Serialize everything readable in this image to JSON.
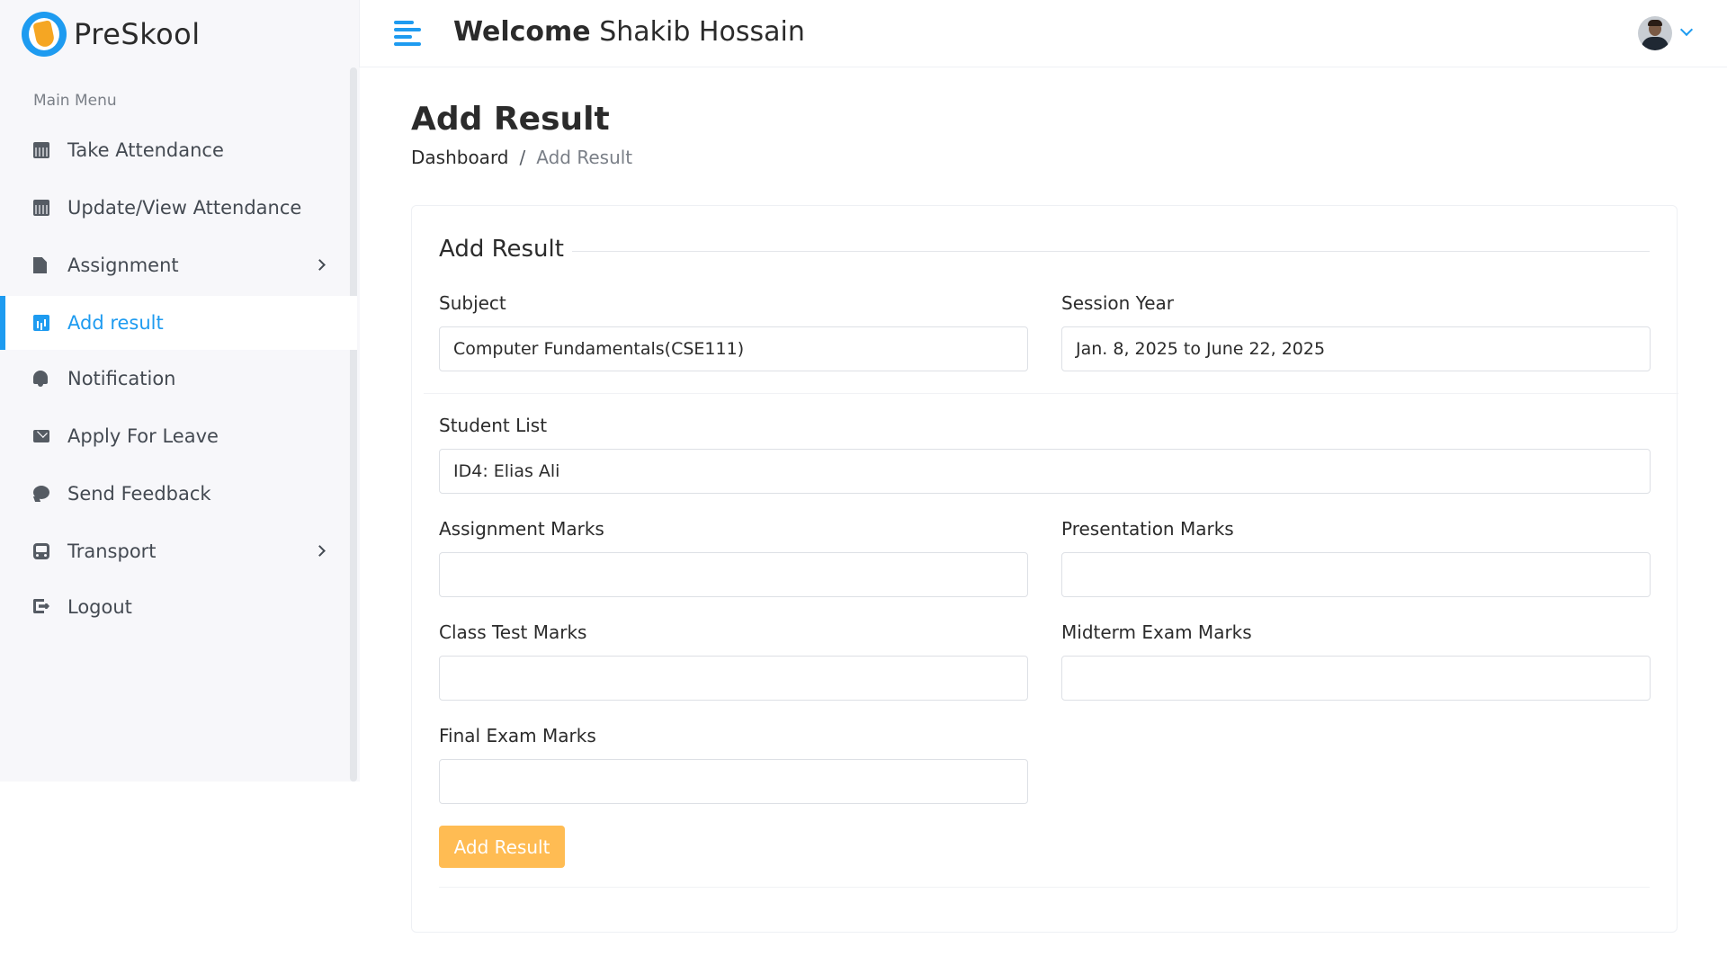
{
  "app": {
    "name": "PreSkool"
  },
  "header": {
    "welcome_label": "Welcome",
    "user_name": "Shakib Hossain"
  },
  "sidebar": {
    "title": "Main Menu",
    "items": [
      {
        "label": "Take Attendance",
        "icon": "calendar-icon"
      },
      {
        "label": "Update/View Attendance",
        "icon": "calendar-icon"
      },
      {
        "label": "Assignment",
        "icon": "file-icon",
        "has_submenu": true
      },
      {
        "label": "Add result",
        "icon": "chart-icon",
        "active": true
      },
      {
        "label": "Notification",
        "icon": "bell-icon"
      },
      {
        "label": "Apply For Leave",
        "icon": "envelope-icon"
      },
      {
        "label": "Send Feedback",
        "icon": "chat-icon"
      },
      {
        "label": "Transport",
        "icon": "bus-icon",
        "has_submenu": true
      },
      {
        "label": "Logout",
        "icon": "logout-icon"
      }
    ]
  },
  "page": {
    "title": "Add Result",
    "breadcrumb": {
      "home": "Dashboard",
      "separator": "/",
      "current": "Add Result"
    }
  },
  "form": {
    "legend": "Add Result",
    "subject": {
      "label": "Subject",
      "value": "Computer Fundamentals(CSE111)"
    },
    "session_year": {
      "label": "Session Year",
      "value": "Jan. 8, 2025 to June 22, 2025"
    },
    "student_list": {
      "label": "Student List",
      "value": "ID4: Elias Ali"
    },
    "assignment_marks": {
      "label": "Assignment Marks",
      "value": ""
    },
    "presentation_marks": {
      "label": "Presentation Marks",
      "value": ""
    },
    "class_test_marks": {
      "label": "Class Test Marks",
      "value": ""
    },
    "midterm_exam_marks": {
      "label": "Midterm Exam Marks",
      "value": ""
    },
    "final_exam_marks": {
      "label": "Final Exam Marks",
      "value": ""
    },
    "submit_label": "Add Result"
  },
  "colors": {
    "accent": "#1e9bf0",
    "button": "#ffbc53",
    "sidebar_bg": "#f7f7fa"
  }
}
